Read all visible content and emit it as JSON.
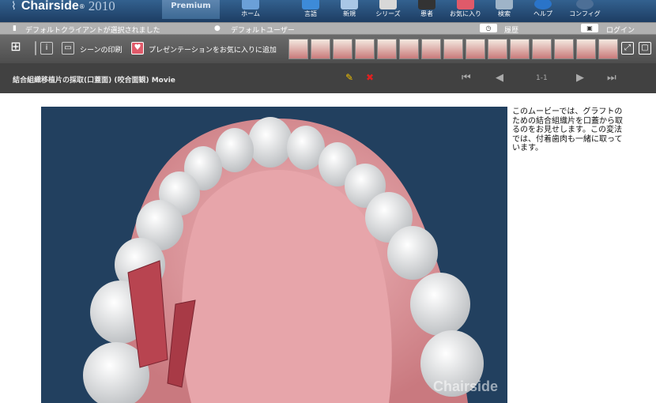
{
  "app": {
    "name": "Chairside",
    "trademark": "®",
    "year": "2010",
    "edition": "Premium"
  },
  "nav": [
    {
      "label": "ホーム",
      "icon": "home-icon"
    },
    {
      "label": "言語",
      "icon": "language-icon"
    },
    {
      "label": "新規",
      "icon": "new-icon"
    },
    {
      "label": "シリーズ",
      "icon": "series-icon"
    },
    {
      "label": "患者",
      "icon": "patient-icon"
    },
    {
      "label": "お気に入り",
      "icon": "favorites-icon"
    },
    {
      "label": "検索",
      "icon": "search-icon"
    },
    {
      "label": "ヘルプ",
      "icon": "help-icon"
    },
    {
      "label": "コンフィグ",
      "icon": "config-icon"
    }
  ],
  "infobar": {
    "client": "デフォルトクライアントが選択されました",
    "user": "デフォルトユーザー",
    "history": "履歴",
    "login": "ログイン"
  },
  "toolbar": {
    "print_label": "シーンの印刷",
    "add_favorite_label": "プレゼンテーションをお気に入りに追加"
  },
  "movie": {
    "title": "結合組織移植片の採取(口蓋面) (咬合面観) Movie",
    "page": "1-1",
    "watermark": "Chairside"
  },
  "description": "このムービーでは、グラフトのための結合組織片を口蓋から取るのをお見せします。この変法では、付着歯肉も一緒に取っています。",
  "colors": {
    "top_bar": "#2a5280",
    "toolbar": "#5a5a5a",
    "title_bar": "#414141",
    "video_bg": "#22405f",
    "accent_red": "#c0392b"
  }
}
